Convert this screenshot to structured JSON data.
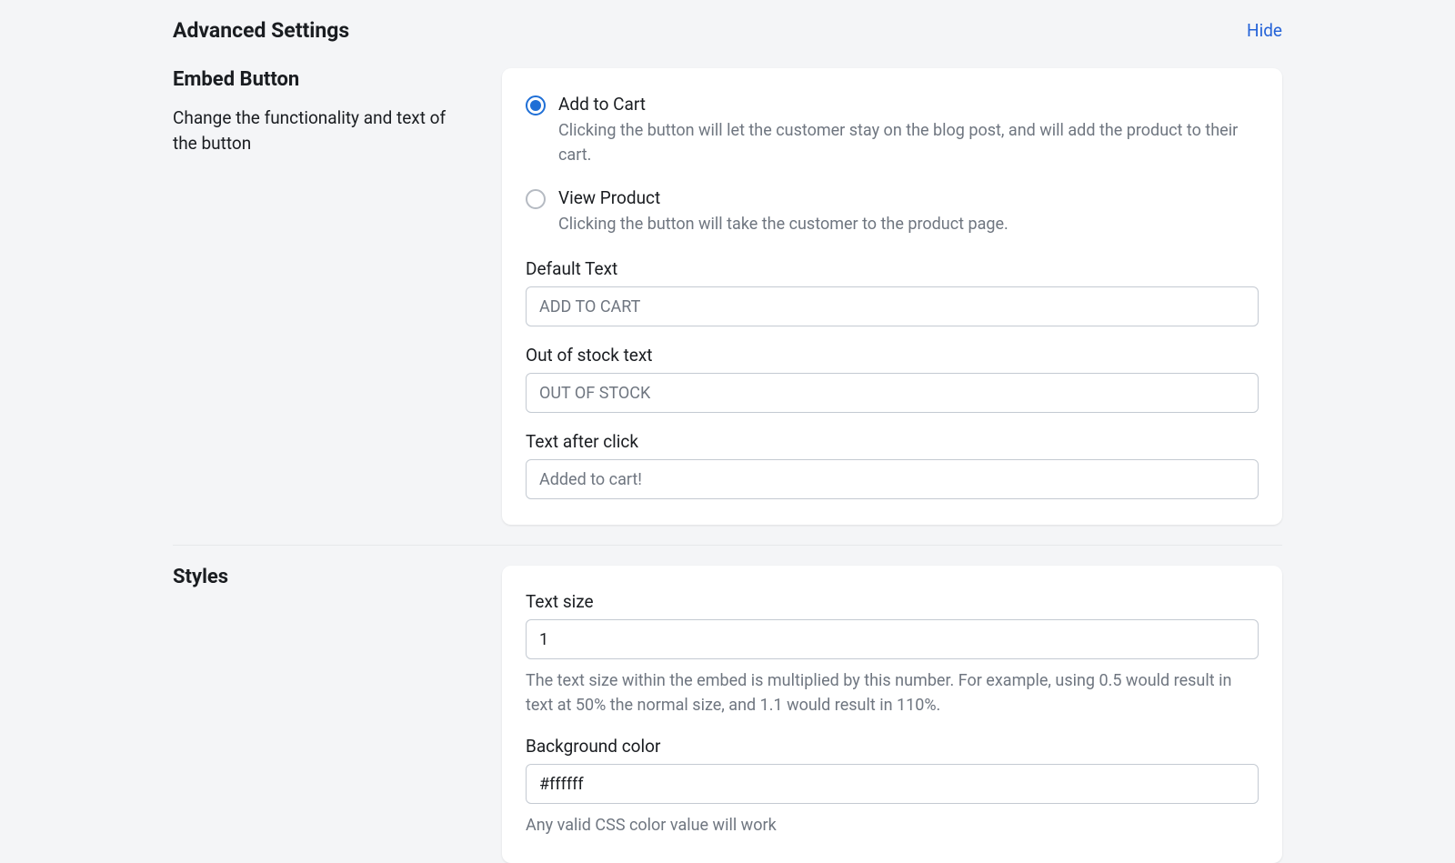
{
  "header": {
    "title": "Advanced Settings",
    "hide_label": "Hide"
  },
  "embed": {
    "section_title": "Embed Button",
    "section_desc": "Change the functionality and text of the button",
    "radios": {
      "add_to_cart": {
        "label": "Add to Cart",
        "desc": "Clicking the button will let the customer stay on the blog post, and will add the product to their cart."
      },
      "view_product": {
        "label": "View Product",
        "desc": "Clicking the button will take the customer to the product page."
      }
    },
    "fields": {
      "default_text": {
        "label": "Default Text",
        "value": "ADD TO CART"
      },
      "out_of_stock": {
        "label": "Out of stock text",
        "value": "OUT OF STOCK"
      },
      "after_click": {
        "label": "Text after click",
        "value": "Added to cart!"
      }
    }
  },
  "styles": {
    "section_title": "Styles",
    "text_size": {
      "label": "Text size",
      "value": "1",
      "help": "The text size within the embed is multiplied by this number. For example, using 0.5 would result in text at 50% the normal size, and 1.1 would result in 110%."
    },
    "bg_color": {
      "label": "Background color",
      "value": "#ffffff",
      "help": "Any valid CSS color value will work"
    }
  }
}
